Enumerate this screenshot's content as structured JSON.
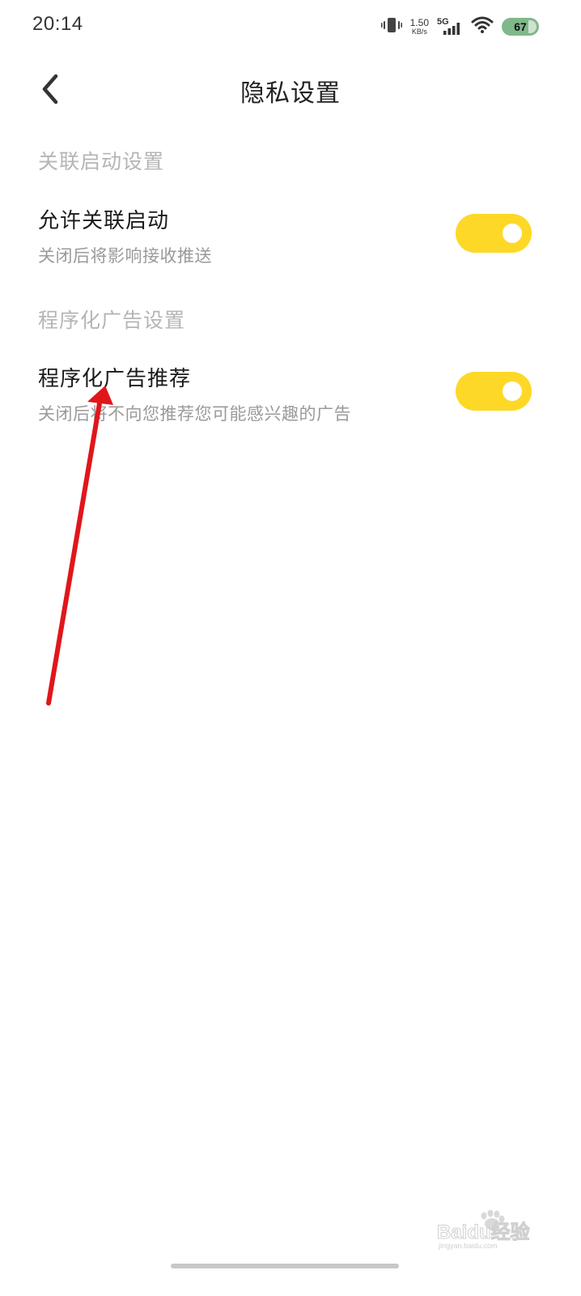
{
  "status_bar": {
    "time": "20:14",
    "net_speed_value": "1.50",
    "net_speed_unit": "KB/s",
    "network_type": "5G",
    "battery_level": "67",
    "battery_color": "#7fb88a"
  },
  "header": {
    "title": "隐私设置",
    "back_icon": "chevron-left-icon"
  },
  "sections": [
    {
      "header": "关联启动设置",
      "items": [
        {
          "title": "允许关联启动",
          "description": "关闭后将影响接收推送",
          "toggle_on": true
        }
      ]
    },
    {
      "header": "程序化广告设置",
      "items": [
        {
          "title": "程序化广告推荐",
          "description": "关闭后将不向您推荐您可能感兴趣的广告",
          "toggle_on": true
        }
      ]
    }
  ],
  "colors": {
    "toggle_on": "#fdd826",
    "annotation_arrow": "#e0161b"
  },
  "watermark": {
    "brand_text": "Baidu经验",
    "sub_text": "jingyan.baidu.com"
  }
}
